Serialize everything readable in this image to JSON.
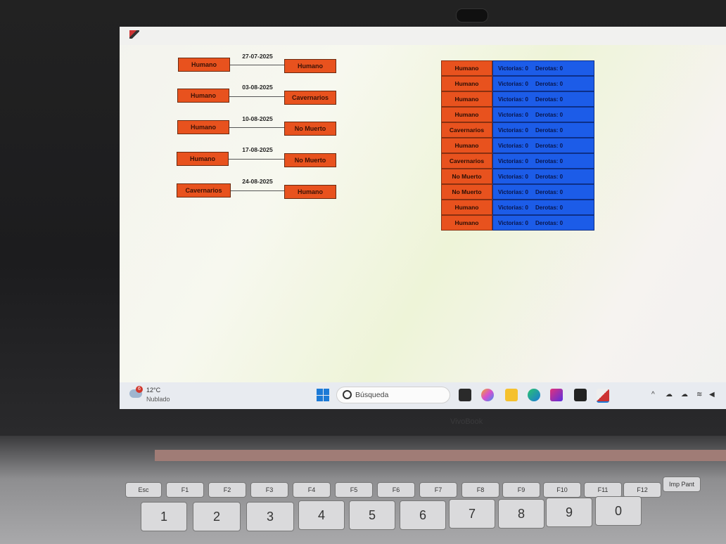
{
  "bracket": {
    "matches": [
      {
        "date": "27-07-2025",
        "left": "Humano",
        "right": "Humano"
      },
      {
        "date": "03-08-2025",
        "left": "Humano",
        "right": "Cavernarios"
      },
      {
        "date": "10-08-2025",
        "left": "Humano",
        "right": "No Muerto"
      },
      {
        "date": "17-08-2025",
        "left": "Humano",
        "right": "No Muerto"
      },
      {
        "date": "24-08-2025",
        "left": "Cavernarios",
        "right": "Humano"
      }
    ]
  },
  "standings": {
    "rows": [
      {
        "name": "Humano",
        "wins": "Victorias: 0",
        "losses": "Derotas: 0"
      },
      {
        "name": "Humano",
        "wins": "Victorias: 0",
        "losses": "Derotas: 0"
      },
      {
        "name": "Humano",
        "wins": "Victorias: 0",
        "losses": "Derotas: 0"
      },
      {
        "name": "Humano",
        "wins": "Victorias: 0",
        "losses": "Derotas: 0"
      },
      {
        "name": "Cavernarios",
        "wins": "Victorias: 0",
        "losses": "Derotas: 0"
      },
      {
        "name": "Humano",
        "wins": "Victorias: 0",
        "losses": "Derotas: 0"
      },
      {
        "name": "Cavernarios",
        "wins": "Victorias: 0",
        "losses": "Derotas: 0"
      },
      {
        "name": "No Muerto",
        "wins": "Victorias: 0",
        "losses": "Derotas: 0"
      },
      {
        "name": "No Muerto",
        "wins": "Victorias: 0",
        "losses": "Derotas: 0"
      },
      {
        "name": "Humano",
        "wins": "Victorias: 0",
        "losses": "Derotas: 0"
      },
      {
        "name": "Humano",
        "wins": "Victorias: 0",
        "losses": "Derotas: 0"
      }
    ]
  },
  "taskbar": {
    "weather_badge": "6",
    "weather_temp": "12°C",
    "weather_desc": "Nublado",
    "search_placeholder": "Búsqueda"
  },
  "laptop": {
    "brand": "VivoBook"
  },
  "keyboard": {
    "fn_keys": [
      "Esc",
      "F1",
      "F2",
      "F3",
      "F4",
      "F5",
      "F6",
      "F7",
      "F8",
      "F9",
      "F10",
      "F11",
      "F12",
      "Imp Pant"
    ],
    "number_keys": [
      "1",
      "2",
      "3",
      "4",
      "5",
      "6",
      "7",
      "8",
      "9",
      "0"
    ]
  },
  "colors": {
    "team_box": "#e8521e",
    "stats_box": "#1c5ce8"
  }
}
